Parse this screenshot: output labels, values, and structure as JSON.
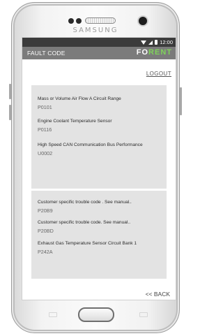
{
  "device": {
    "brand": "SAMSUNG"
  },
  "status_bar": {
    "time": "12:00",
    "icons": [
      "wifi-icon",
      "signal-icon",
      "battery-icon"
    ]
  },
  "app_bar": {
    "title": "FAULT CODE",
    "logo_part1": "FO",
    "logo_part2": "RENT",
    "colors": {
      "bar": "#7b7b7b",
      "logo_accent": "#7fd35a"
    }
  },
  "actions": {
    "logout_label": "LOGOUT",
    "back_label": "<< BACK"
  },
  "fault_codes": [
    {
      "description": "Mass or Volume Air Flow A Circuit  Range",
      "code": "P0101"
    },
    {
      "description": "Engine Coolant Temperature  Sensor",
      "code": "P0116"
    },
    {
      "description": "High Speed CAN Communication Bus Performance",
      "code": "U0002"
    },
    {
      "description": "Customer  specific  trouble code . See manual..",
      "code": "P20B9"
    },
    {
      "description": "Customer specific trouble code. See manual..",
      "code": "P20BD"
    },
    {
      "description": "Exhaust Gas Temperature Sensor Circuit Bank 1",
      "code": "P242A"
    }
  ]
}
